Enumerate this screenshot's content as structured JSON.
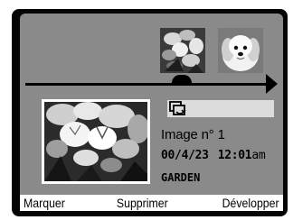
{
  "image_info": {
    "image_label": "Image n° 1",
    "date": "00/4/23",
    "time": "12:01",
    "time_suffix": "am",
    "folder": "GARDEN"
  },
  "filmstrip": {
    "thumbnails": [
      {
        "subject": "flower"
      },
      {
        "subject": "dog"
      }
    ]
  },
  "icons": {
    "rotate": "rotate-icon",
    "timeline_arrow": "arrow-right-icon",
    "playhead": "playhead-icon"
  },
  "softkeys": {
    "left": "Marquer",
    "middle": "Supprimer",
    "right": "Développer"
  }
}
